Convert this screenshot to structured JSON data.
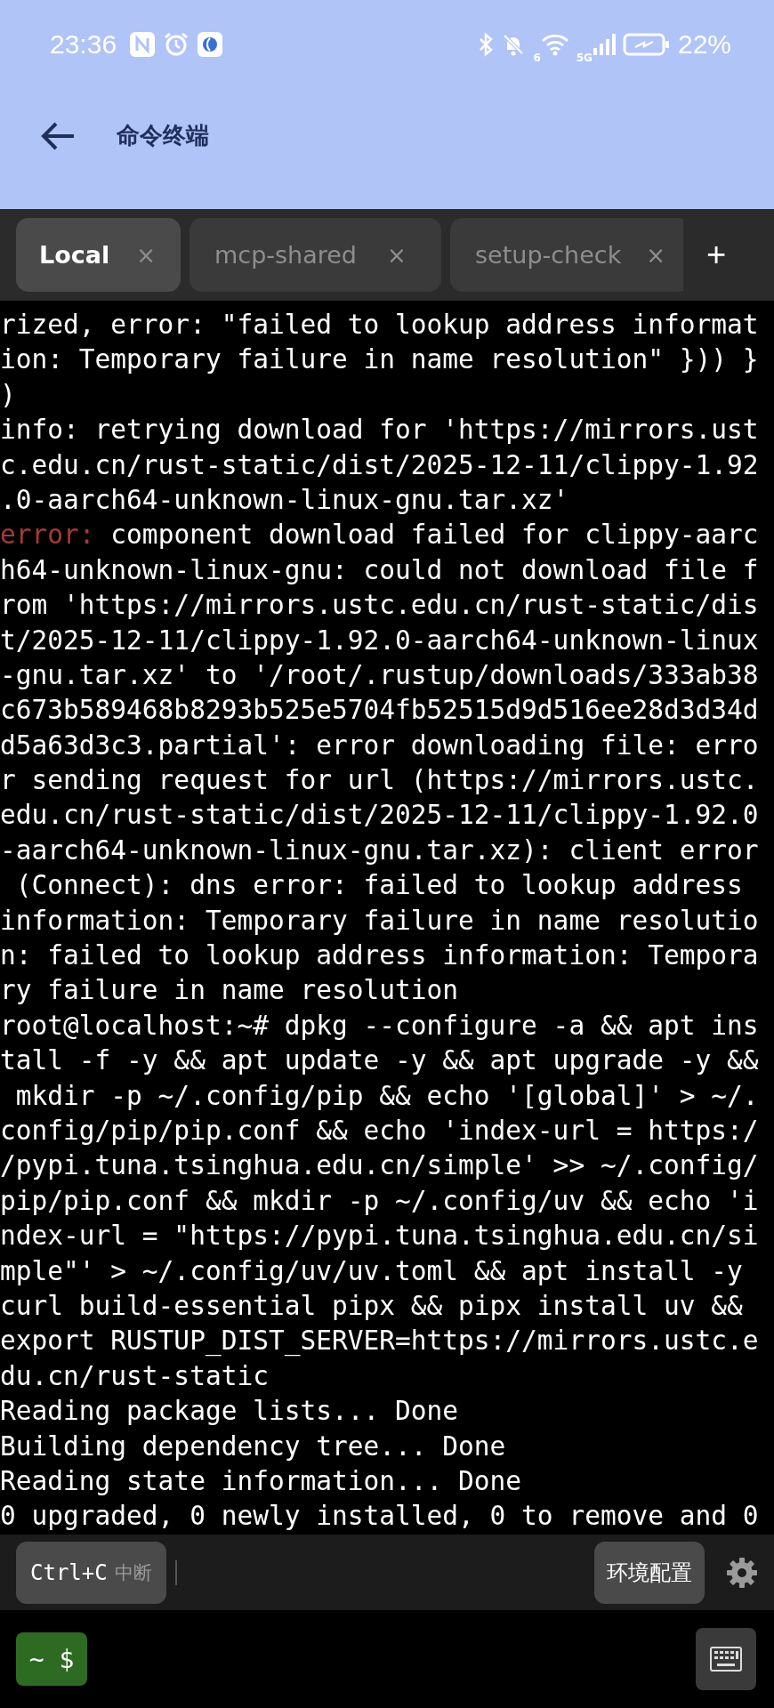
{
  "status_bar": {
    "time": "23:36",
    "wifi_label": "6",
    "network": "5G",
    "battery": "22%"
  },
  "header": {
    "title": "命令终端"
  },
  "tabs": [
    {
      "label": "Local",
      "close": "×",
      "selected": true
    },
    {
      "label": "mcp-shared",
      "close": "×",
      "selected": false
    },
    {
      "label": "setup-check",
      "close": "×",
      "selected": false
    }
  ],
  "new_tab": "+",
  "terminal": {
    "lines": [
      {
        "text": "rized, error: \"failed to lookup address informat"
      },
      {
        "text": "ion: Temporary failure in name resolution\" })) }"
      },
      {
        "text": ")"
      },
      {
        "text": "info: retrying download for 'https://mirrors.ust"
      },
      {
        "text": "c.edu.cn/rust-static/dist/2025-12-11/clippy-1.92"
      },
      {
        "text": ".0-aarch64-unknown-linux-gnu.tar.xz'"
      },
      {
        "kind": "error",
        "label": "error:",
        "text": "component download failed for clippy-aarc"
      },
      {
        "text": "h64-unknown-linux-gnu: could not download file f"
      },
      {
        "text": "rom 'https://mirrors.ustc.edu.cn/rust-static/dis"
      },
      {
        "text": "t/2025-12-11/clippy-1.92.0-aarch64-unknown-linux"
      },
      {
        "text": "-gnu.tar.xz' to '/root/.rustup/downloads/333ab38"
      },
      {
        "text": "c673b589468b8293b525e5704fb52515d9d516ee28d3d34d"
      },
      {
        "text": "d5a63d3c3.partial': error downloading file: erro"
      },
      {
        "text": "r sending request for url (https://mirrors.ustc."
      },
      {
        "text": "edu.cn/rust-static/dist/2025-12-11/clippy-1.92.0"
      },
      {
        "text": "-aarch64-unknown-linux-gnu.tar.xz): client error"
      },
      {
        "text": " (Connect): dns error: failed to lookup address"
      },
      {
        "text": "information: Temporary failure in name resolutio"
      },
      {
        "text": "n: failed to lookup address information: Tempora"
      },
      {
        "text": "ry failure in name resolution"
      },
      {
        "text": "root@localhost:~# dpkg --configure -a && apt ins"
      },
      {
        "text": "tall -f -y && apt update -y && apt upgrade -y &&"
      },
      {
        "text": " mkdir -p ~/.config/pip && echo '[global]' > ~/."
      },
      {
        "text": "config/pip/pip.conf && echo 'index-url = https:/"
      },
      {
        "text": "/pypi.tuna.tsinghua.edu.cn/simple' >> ~/.config/"
      },
      {
        "text": "pip/pip.conf && mkdir -p ~/.config/uv && echo 'i"
      },
      {
        "text": "ndex-url = \"https://pypi.tuna.tsinghua.edu.cn/si"
      },
      {
        "text": "mple\"' > ~/.config/uv/uv.toml && apt install -y"
      },
      {
        "text": "curl build-essential pipx && pipx install uv &&"
      },
      {
        "text": "export RUSTUP_DIST_SERVER=https://mirrors.ustc.e"
      },
      {
        "text": "du.cn/rust-static"
      },
      {
        "text": "Reading package lists... Done"
      },
      {
        "text": "Building dependency tree... Done"
      },
      {
        "text": "Reading state information... Done"
      },
      {
        "text": "0 upgraded, 0 newly installed, 0 to remove and 0"
      }
    ]
  },
  "toolbar": {
    "interrupt_key": "Ctrl+C",
    "interrupt_label": "中断",
    "env_button": "环境配置"
  },
  "prompt": {
    "label": "~ $"
  }
}
